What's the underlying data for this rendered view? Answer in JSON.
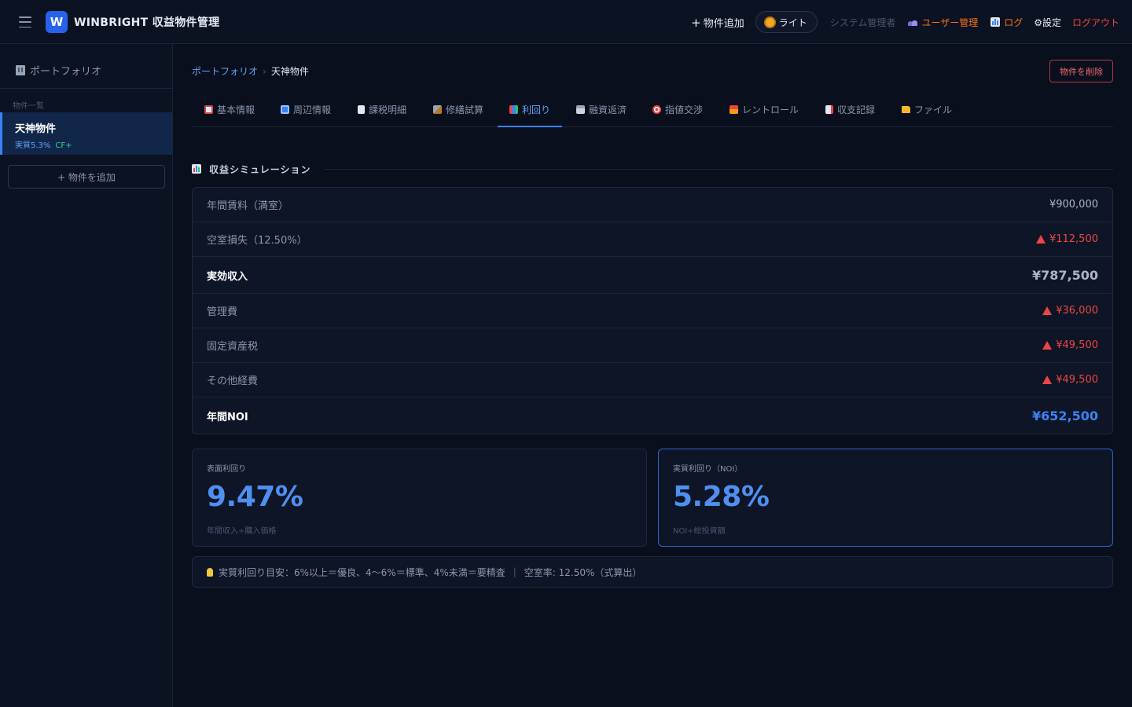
{
  "header": {
    "app_title": "WINBRIGHT 収益物件管理",
    "logo_letter": "W",
    "add_property": "物件追加",
    "theme_toggle": "ライト",
    "role": "システム管理者",
    "user_management": "ユーザー管理",
    "log": "ログ",
    "settings": "⚙設定",
    "logout": "ログアウト"
  },
  "sidebar": {
    "portfolio_label": "ポートフォリオ",
    "section_label": "物件一覧",
    "items": [
      {
        "name": "天神物件",
        "yield": "実質5.3%",
        "cf": "CF+"
      }
    ],
    "add_button": "+ 物件を追加"
  },
  "breadcrumb": {
    "root": "ポートフォリオ",
    "separator": "›",
    "current": "天神物件"
  },
  "delete_button": "物件を削除",
  "tabs": [
    {
      "label": "基本情報",
      "icon": "clipboard-icon"
    },
    {
      "label": "周辺情報",
      "icon": "map-icon"
    },
    {
      "label": "課税明細",
      "icon": "document-icon"
    },
    {
      "label": "修繕試算",
      "icon": "hammer-icon"
    },
    {
      "label": "利回り",
      "icon": "chart-icon"
    },
    {
      "label": "融資返済",
      "icon": "bank-icon"
    },
    {
      "label": "指値交渉",
      "icon": "target-icon"
    },
    {
      "label": "レントロール",
      "icon": "house-icon"
    },
    {
      "label": "収支記録",
      "icon": "ledger-icon"
    },
    {
      "label": "ファイル",
      "icon": "folder-icon"
    }
  ],
  "active_tab": "利回り",
  "simulation": {
    "title": "収益シミュレーション",
    "rows": [
      {
        "label": "年間賃料（満室）",
        "value": "¥900,000"
      },
      {
        "label": "空室損失（12.50%）",
        "value": "¥112,500"
      },
      {
        "label": "実効収入",
        "value": "¥787,500"
      },
      {
        "label": "管理費",
        "value": "¥36,000"
      },
      {
        "label": "固定資産税",
        "value": "¥49,500"
      },
      {
        "label": "その他経費",
        "value": "¥49,500"
      },
      {
        "label": "年間NOI",
        "value": "¥652,500"
      }
    ]
  },
  "kpis": {
    "gross": {
      "label": "表面利回り",
      "value": "9.47%",
      "sub": "年間収入÷購入価格"
    },
    "net": {
      "label": "実質利回り（NOI）",
      "value": "5.28%",
      "sub": "NOI÷総投資額"
    }
  },
  "hint": {
    "text": "実質利回り目安：6%以上＝優良、4〜6%＝標準、4%未満＝要精査",
    "separator": "|",
    "vacancy": "空室率: 12.50%（式算出）"
  },
  "colors": {
    "accent": "#3b82f6",
    "negative": "#ef4444",
    "danger": "#ef6b6b",
    "positive": "#34d399",
    "warning": "#f97316",
    "background": "#0a0f1d"
  }
}
